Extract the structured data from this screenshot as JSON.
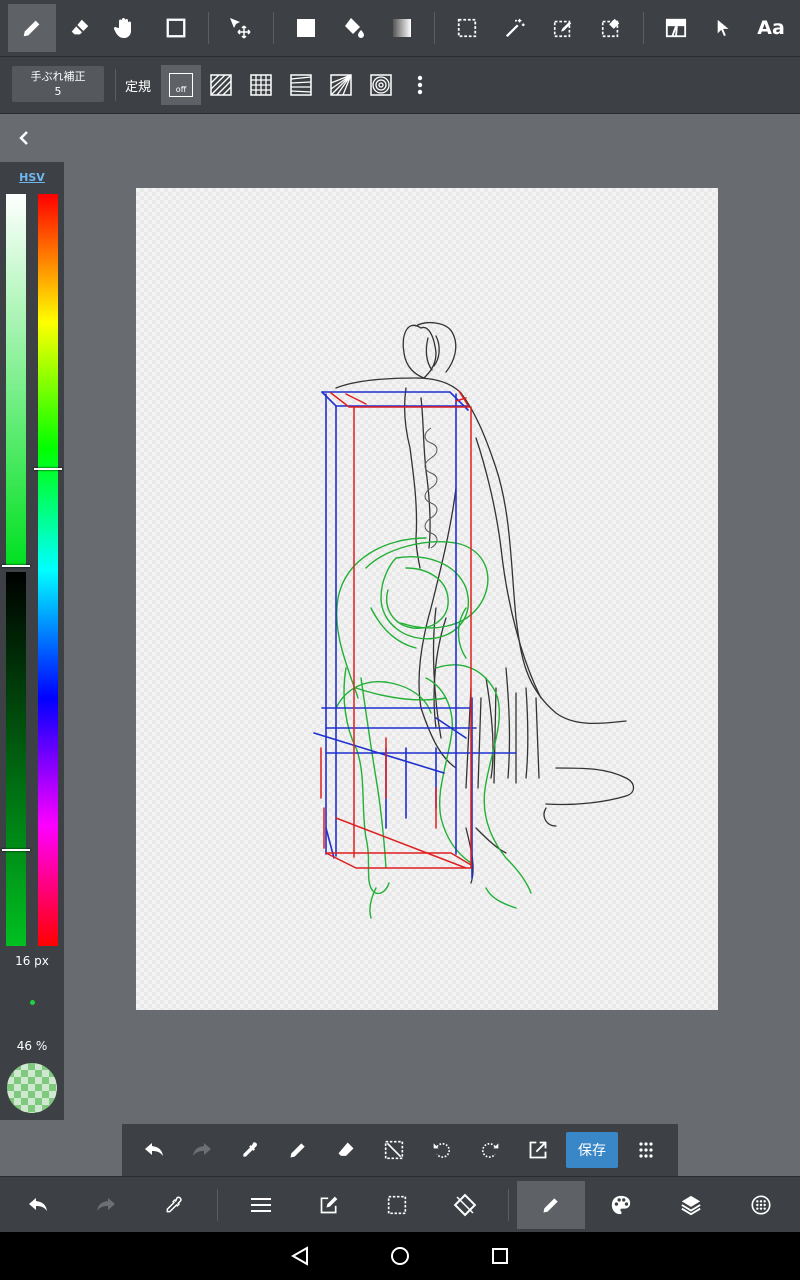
{
  "top_toolbar": {
    "tools": [
      "pen-icon",
      "eraser-icon",
      "hand-icon",
      "rectangle-icon",
      "move-icon",
      "fill-rect-icon",
      "bucket-icon",
      "gradient-icon",
      "select-rect-icon",
      "magic-wand-icon",
      "select-pen-icon",
      "select-eraser-icon",
      "layer-frame-icon",
      "pointer-icon",
      "text-icon"
    ],
    "text_tool_label": "Aa",
    "active_tool": "pen-icon"
  },
  "sub_toolbar": {
    "stabilizer_label": "手ぶれ補正",
    "stabilizer_value": "5",
    "ruler_label": "定規",
    "ruler_off_label": "off",
    "ruler_modes": [
      "ruler-off-icon",
      "parallel-lines-icon",
      "grid-icon",
      "perspective-lines-icon",
      "perspective-2-icon",
      "concentric-icon"
    ]
  },
  "color_panel": {
    "mode_label": "HSV",
    "brush_size_label": "16 px",
    "opacity_label": "46 %",
    "current_color": "#20d040"
  },
  "action_bar": {
    "save_label": "保存",
    "icons": [
      "undo-icon",
      "redo-icon",
      "eyedropper-icon",
      "pen-icon",
      "eraser-icon",
      "clear-selection-icon",
      "rotate-left-icon",
      "rotate-right-icon",
      "export-icon",
      "grid-menu-icon"
    ]
  },
  "bottom_bar": {
    "icons": [
      "undo-icon",
      "redo-icon",
      "eyedropper-icon",
      "menu-icon",
      "edit-icon",
      "selection-icon",
      "transform-icon",
      "brush-icon",
      "palette-icon",
      "layers-icon",
      "settings-icon"
    ],
    "active": "brush-icon"
  },
  "nav_bar": {
    "icons": [
      "back-triangle-icon",
      "home-circle-icon",
      "recents-square-icon"
    ]
  },
  "colors": {
    "toolbar_bg": "#3d4044",
    "workspace_bg": "#686c71",
    "save_button": "#3a87c8",
    "sketch_red": "#e02020",
    "sketch_blue": "#2020d0",
    "sketch_green": "#20b030"
  }
}
